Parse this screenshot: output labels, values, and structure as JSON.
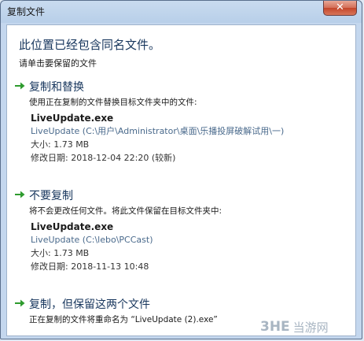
{
  "window": {
    "title": "复制文件",
    "close_glyph": "✕"
  },
  "dialog": {
    "heading": "此位置已经包含同名文件。",
    "subheading": "请单击要保留的文件"
  },
  "options": [
    {
      "title": "复制和替换",
      "description": "使用正在复制的文件替换目标文件夹中的文件:",
      "file_name": "LiveUpdate.exe",
      "path": "LiveUpdate (C:\\用户\\Administrator\\桌面\\乐播投屏破解试用\\一)",
      "size": "大小: 1.73 MB",
      "modified": "修改日期: 2018-12-04 22:20 (较新)"
    },
    {
      "title": "不要复制",
      "description": "将不会更改任何文件。将此文件保留在目标文件夹中:",
      "file_name": "LiveUpdate.exe",
      "path": "LiveUpdate (C:\\lebo\\PCCast)",
      "size": "大小: 1.73 MB",
      "modified": "修改日期: 2018-11-13 10:48"
    },
    {
      "title": "复制，但保留这两个文件",
      "description": "正在复制的文件将重命名为 “LiveUpdate (2).exe”"
    }
  ],
  "watermark": {
    "logo": "3HE",
    "text": "当游网"
  },
  "colors": {
    "arrow": "#2e9b2e",
    "title_text": "#17365d",
    "path_text": "#4a6a8c"
  },
  "icons": {
    "option_arrow": "green-arrow-icon"
  }
}
